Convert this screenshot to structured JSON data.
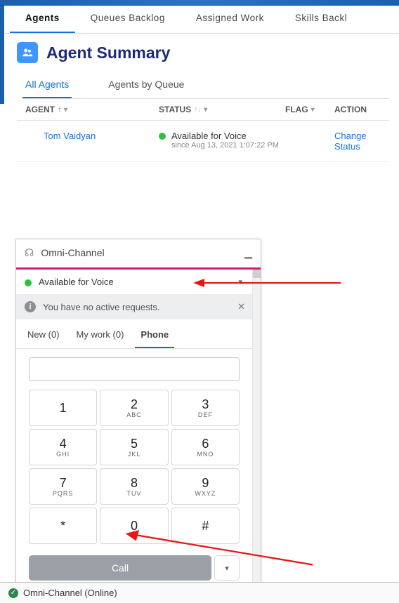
{
  "page_tabs": {
    "agents": "Agents",
    "queues": "Queues Backlog",
    "assigned": "Assigned Work",
    "skills": "Skills Backl"
  },
  "summary": {
    "title": "Agent Summary"
  },
  "sub_tabs": {
    "all": "All Agents",
    "by_queue": "Agents by Queue"
  },
  "columns": {
    "agent": "AGENT",
    "status": "STATUS",
    "flag": "FLAG",
    "action": "ACTION"
  },
  "rows": [
    {
      "agent": "Tom Vaidyan",
      "status": "Available for Voice",
      "since": "since  Aug 13, 2021 1:07:22 PM",
      "action": "Change Status"
    }
  ],
  "omni": {
    "title": "Omni-Channel",
    "status": "Available for Voice",
    "info": "You have no active requests.",
    "tabs": {
      "new": "New (0)",
      "mywork": "My work (0)",
      "phone": "Phone"
    },
    "dialpad": [
      {
        "d": "1",
        "l": ""
      },
      {
        "d": "2",
        "l": "ABC"
      },
      {
        "d": "3",
        "l": "DEF"
      },
      {
        "d": "4",
        "l": "GHI"
      },
      {
        "d": "5",
        "l": "JKL"
      },
      {
        "d": "6",
        "l": "MNO"
      },
      {
        "d": "7",
        "l": "PQRS"
      },
      {
        "d": "8",
        "l": "TUV"
      },
      {
        "d": "9",
        "l": "WXYZ"
      },
      {
        "d": "*",
        "l": ""
      },
      {
        "d": "0",
        "l": ""
      },
      {
        "d": "#",
        "l": ""
      }
    ],
    "call": "Call"
  },
  "footer": {
    "label": "Omni-Channel (Online)"
  }
}
